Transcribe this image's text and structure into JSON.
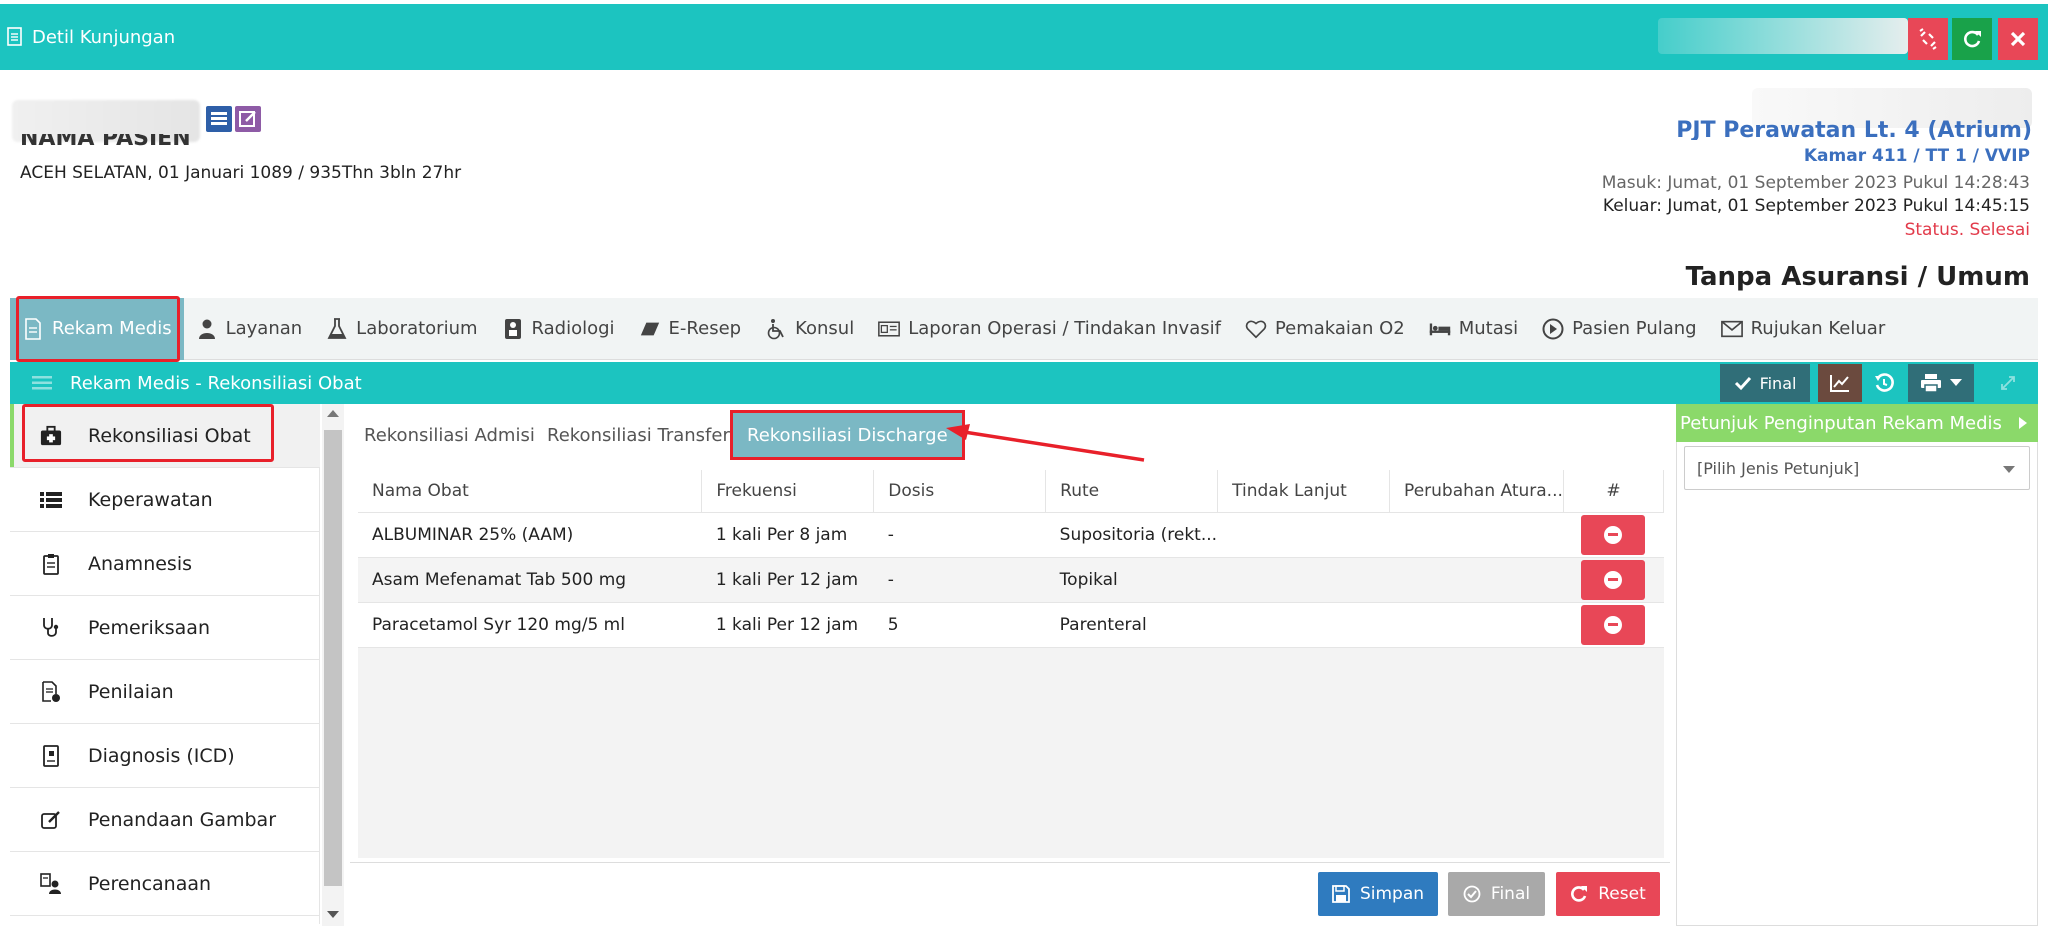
{
  "window": {
    "title": "Detil Kunjungan"
  },
  "patient": {
    "name_label": "NAMA PASIEN",
    "info": "ACEH SELATAN, 01 Januari 1089 / 935Thn 3bln 27hr"
  },
  "visit": {
    "unit": "PJT Perawatan Lt. 4 (Atrium)",
    "room": "Kamar 411 / TT 1 / VVIP",
    "masuk": "Masuk: Jumat, 01 September 2023 Pukul 14:28:43",
    "keluar": "Keluar: Jumat, 01 September 2023 Pukul 14:45:15",
    "status": "Status. Selesai",
    "insurance": "Tanpa Asuransi / Umum"
  },
  "main_tabs": [
    {
      "label": "Rekam Medis",
      "icon": "document-icon"
    },
    {
      "label": "Layanan",
      "icon": "doctor-icon"
    },
    {
      "label": "Laboratorium",
      "icon": "flask-icon"
    },
    {
      "label": "Radiologi",
      "icon": "xray-icon"
    },
    {
      "label": "E-Resep",
      "icon": "eraser-icon"
    },
    {
      "label": "Konsul",
      "icon": "wheelchair-icon"
    },
    {
      "label": "Laporan Operasi / Tindakan Invasif",
      "icon": "id-card-icon"
    },
    {
      "label": "Pemakaian O2",
      "icon": "heart-icon"
    },
    {
      "label": "Mutasi",
      "icon": "bed-icon"
    },
    {
      "label": "Pasien Pulang",
      "icon": "circle-arrow-icon"
    },
    {
      "label": "Rujukan Keluar",
      "icon": "envelope-icon"
    }
  ],
  "subheader": {
    "title": "Rekam Medis - Rekonsiliasi Obat",
    "final_label": "Final"
  },
  "sidebar": [
    {
      "label": "Rekonsiliasi Obat",
      "icon": "medkit-icon"
    },
    {
      "label": "Keperawatan",
      "icon": "list-icon"
    },
    {
      "label": "Anamnesis",
      "icon": "clipboard-icon"
    },
    {
      "label": "Pemeriksaan",
      "icon": "stethoscope-icon"
    },
    {
      "label": "Penilaian",
      "icon": "file-check-icon"
    },
    {
      "label": "Diagnosis (ICD)",
      "icon": "file-medical-icon"
    },
    {
      "label": "Penandaan Gambar",
      "icon": "edit-icon"
    },
    {
      "label": "Perencanaan",
      "icon": "user-file-icon"
    }
  ],
  "sub_tabs": [
    {
      "label": "Rekonsiliasi Admisi"
    },
    {
      "label": "Rekonsiliasi Transfer"
    },
    {
      "label": "Rekonsiliasi Discharge"
    }
  ],
  "table": {
    "columns": [
      "Nama Obat",
      "Frekuensi",
      "Dosis",
      "Rute",
      "Tindak Lanjut",
      "Perubahan Atura...",
      "#"
    ],
    "rows": [
      {
        "nama": "ALBUMINAR 25% (AAM)",
        "frekuensi": "1 kali Per 8 jam",
        "dosis": "-",
        "rute": "Supositoria (rekt...",
        "tindak": "",
        "perubahan": ""
      },
      {
        "nama": "Asam Mefenamat Tab 500 mg",
        "frekuensi": "1 kali Per 12 jam",
        "dosis": "-",
        "rute": "Topikal",
        "tindak": "",
        "perubahan": ""
      },
      {
        "nama": "Paracetamol Syr 120 mg/5 ml",
        "frekuensi": "1 kali Per 12 jam",
        "dosis": "5",
        "rute": "Parenteral",
        "tindak": "",
        "perubahan": ""
      }
    ]
  },
  "footer": {
    "simpan": "Simpan",
    "final": "Final",
    "reset": "Reset"
  },
  "right_panel": {
    "title": "Petunjuk Penginputan Rekam Medis",
    "select_placeholder": "[Pilih Jenis Petunjuk]"
  },
  "colors": {
    "teal": "#1cc4c0",
    "active_tab": "#7bb8c4",
    "highlight": "#e8202a",
    "danger": "#e84757",
    "success": "#19a24a",
    "primary": "#2f7bbf",
    "green_panel": "#8bd96a"
  }
}
